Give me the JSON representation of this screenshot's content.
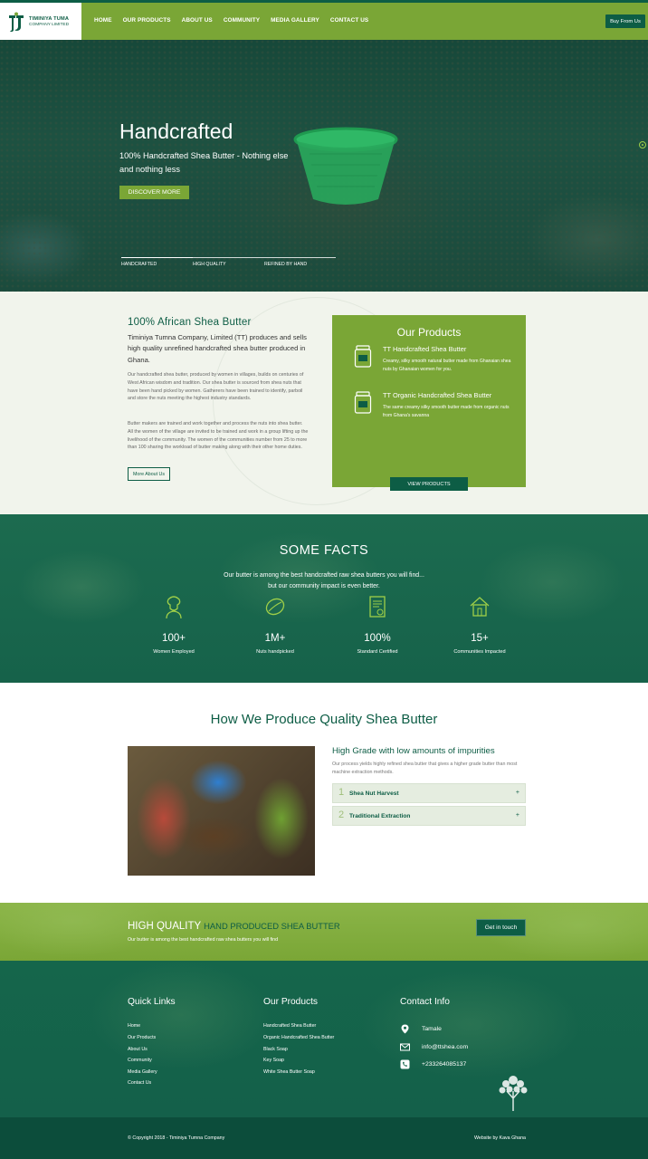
{
  "header": {
    "logo_line1": "TIMINIYA TUMA",
    "logo_line2": "COMPANY LIMITED",
    "nav": [
      "HOME",
      "OUR PRODUCTS",
      "ABOUT US",
      "COMMUNITY",
      "MEDIA GALLERY",
      "CONTACT US"
    ],
    "buy_label": "Buy From Us"
  },
  "hero": {
    "title": "Handcrafted",
    "subtitle": "100% Handcrafted Shea Butter - Nothing else and nothing less",
    "cta_label": "DISCOVER MORE",
    "tabs": [
      "HANDCRAFTED",
      "HIGH QUALITY",
      "REFINED BY HAND"
    ]
  },
  "intro": {
    "title": "100% African Shea Butter",
    "lead": "Timiniya Tumna Company, Limited (TT) produces and sells high quality unrefined handcrafted shea butter produced in Ghana.",
    "para1": "Our handcrafted shea butter, produced by women in villages, builds on centuries of West African wisdom and tradition. Our shea butter is sourced from shea nuts that have been hand picked by women. Gatherers have been trained to identify, parboil and store the nuts meeting the highest industry standards.",
    "para2": "Butter makers are trained and work together and process the nuts into shea butter. All the women of the village are invited to be trained and work in a group lifting up the livelihood of the community. The women of the communities number from 25 to more than 100 sharing the workload of butter making along with their other home duties.",
    "more_label": "More About Us"
  },
  "products": {
    "title": "Our Products",
    "items": [
      {
        "name": "TT Handcrafted Shea Butter",
        "desc": "Creamy, silky smooth natural butter made from Ghanaian shea nuts by Ghanaian women for you."
      },
      {
        "name": "TT Organic Handcrafted Shea Butter",
        "desc": "The same creamy silky smooth butter made from organic nuts from Ghana's savanna"
      }
    ],
    "view_label": "VIEW PRODUCTS"
  },
  "facts": {
    "title": "SOME FACTS",
    "sub1": "Our butter is among the best handcrafted raw shea butters you will find...",
    "sub2": "but our community impact is even better.",
    "items": [
      {
        "num": "100+",
        "label": "Women Employed",
        "icon": "woman-icon"
      },
      {
        "num": "1M+",
        "label": "Nuts handpicked",
        "icon": "nut-icon"
      },
      {
        "num": "100%",
        "label": "Standard Certified",
        "icon": "certificate-icon"
      },
      {
        "num": "15+",
        "label": "Communities Impacted",
        "icon": "house-icon"
      }
    ]
  },
  "process": {
    "title": "How We Produce Quality Shea Butter",
    "heading": "High Grade with low amounts of impurities",
    "para": "Our process yields highly refined shea butter that gives a higher grade butter than most machine extraction methods.",
    "steps": [
      {
        "num": "1",
        "label": "Shea Nut Harvest"
      },
      {
        "num": "2",
        "label": "Traditional Extraction"
      }
    ]
  },
  "cta": {
    "h1": "HIGH QUALITY",
    "h2": "HAND PRODUCED SHEA BUTTER",
    "sub": "Our butter is among the best handcrafted raw shea butters you will find",
    "button": "Get in touch"
  },
  "footer": {
    "quick_title": "Quick Links",
    "quick_links": [
      "Home",
      "Our Products",
      "About Us",
      "Community",
      "Media Gallery",
      "Contact Us"
    ],
    "products_title": "Our Products",
    "product_links": [
      "Handcrafted Shea Butter",
      "Organic Handcrafted Shea Butter",
      "Black Soap",
      "Key Soap",
      "White Shea Butter Soap"
    ],
    "contact_title": "Contact Info",
    "contact": [
      {
        "icon": "location-pin-icon",
        "text": "Tamale"
      },
      {
        "icon": "mail-icon",
        "text": "info@ttshea.com"
      },
      {
        "icon": "phone-icon",
        "text": "+233264085137"
      }
    ],
    "copyright": "© Copyright 2018 - Timiniya Tumna Company",
    "credit": "Website by Kava Ghana"
  },
  "colors": {
    "brand_dark": "#0d5d45",
    "brand_green": "#7aa636",
    "facts_bg": "#1c6b4f"
  }
}
